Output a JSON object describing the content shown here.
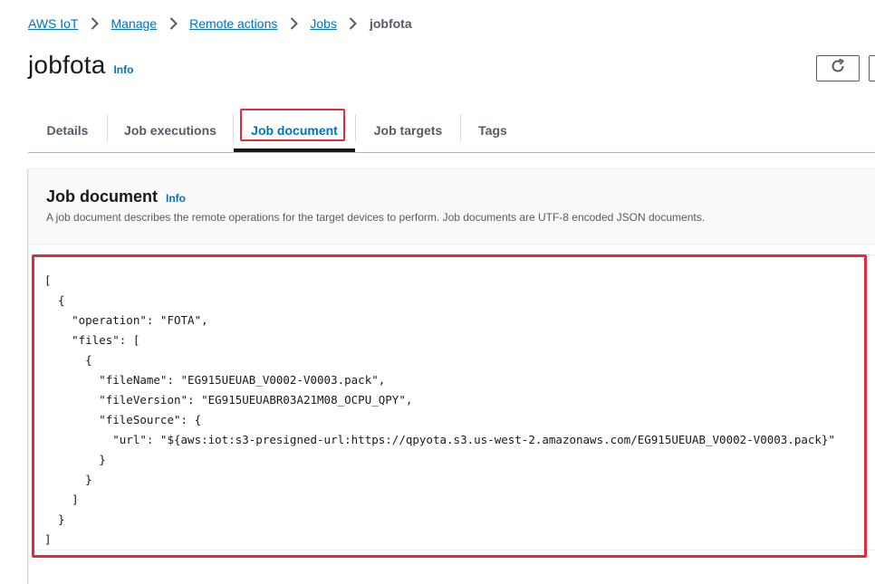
{
  "breadcrumb": {
    "items": [
      "AWS IoT",
      "Manage",
      "Remote actions",
      "Jobs"
    ],
    "current": "jobfota"
  },
  "header": {
    "title": "jobfota",
    "info": "Info"
  },
  "tabs": [
    {
      "label": "Details"
    },
    {
      "label": "Job executions"
    },
    {
      "label": "Job document"
    },
    {
      "label": "Job targets"
    },
    {
      "label": "Tags"
    }
  ],
  "active_tab": "Job document",
  "section": {
    "title": "Job document",
    "info": "Info",
    "description": "A job document describes the remote operations for the target devices to perform. Job documents are UTF-8 encoded JSON documents."
  },
  "job_document": "[\n  {\n    \"operation\": \"FOTA\",\n    \"files\": [\n      {\n        \"fileName\": \"EG915UEUAB_V0002-V0003.pack\",\n        \"fileVersion\": \"EG915UEUABR03A21M08_OCPU_QPY\",\n        \"fileSource\": {\n          \"url\": \"${aws:iot:s3-presigned-url:https://qpyota.s3.us-west-2.amazonaws.com/EG915UEUAB_V0002-V0003.pack}\"\n        }\n      }\n    ]\n  }\n]",
  "colors": {
    "link": "#0073bb",
    "highlight": "#e02d3c",
    "text": "#16191f"
  },
  "icons": {
    "refresh": "refresh-icon",
    "separator": "chevron-right-icon"
  }
}
